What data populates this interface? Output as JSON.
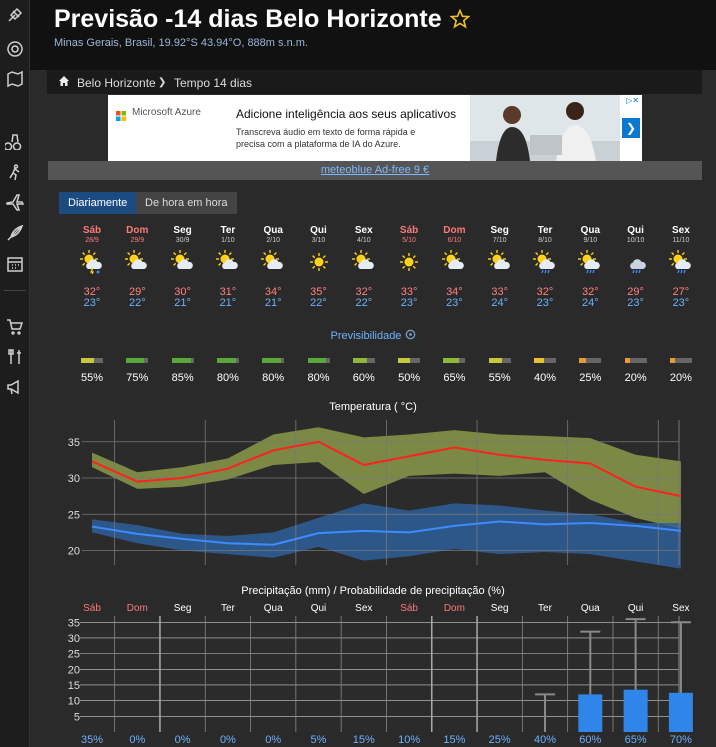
{
  "header": {
    "title": "Previsão -14 dias Belo Horizonte",
    "subtitle": "Minas Gerais, Brasil, 19.92°S 43.94°O, 888m s.n.m."
  },
  "breadcrumb": {
    "home": "Belo Horizonte",
    "sep": "❯",
    "current": "Tempo 14 dias"
  },
  "ad": {
    "brand": "Microsoft Azure",
    "headline": "Adicione inteligência aos seus aplicativos",
    "body1": "Transcreva áudio em texto de forma rápida e",
    "body2": "precisa com a plataforma de IA do Azure."
  },
  "adfree": "meteoblue Ad-free 9 €",
  "tabs": {
    "daily": "Diariamente",
    "hourly": "De hora em hora"
  },
  "sidebar_icons": [
    "satellite-icon",
    "radar-icon",
    "map-icon",
    "binoculars-icon",
    "hiking-icon",
    "plane-icon",
    "feather-icon",
    "calendar-icon",
    "cart-icon",
    "tools-icon",
    "megaphone-icon"
  ],
  "days": [
    {
      "name": "Sáb",
      "date": "28/9",
      "weekend": true,
      "icon": "sun-cloud-thunder",
      "max": "32°",
      "min": "23°",
      "pred": "55%",
      "pred_value": 0.55
    },
    {
      "name": "Dom",
      "date": "29/9",
      "weekend": true,
      "icon": "sun-cloud",
      "max": "29°",
      "min": "22°",
      "pred": "75%",
      "pred_value": 0.75
    },
    {
      "name": "Seg",
      "date": "30/9",
      "weekend": false,
      "icon": "sun-cloud",
      "max": "30°",
      "min": "21°",
      "pred": "85%",
      "pred_value": 0.85
    },
    {
      "name": "Ter",
      "date": "1/10",
      "weekend": false,
      "icon": "sun-cloud",
      "max": "31°",
      "min": "21°",
      "pred": "80%",
      "pred_value": 0.8
    },
    {
      "name": "Qua",
      "date": "2/10",
      "weekend": false,
      "icon": "sun-cloud",
      "max": "34°",
      "min": "21°",
      "pred": "80%",
      "pred_value": 0.8
    },
    {
      "name": "Qui",
      "date": "3/10",
      "weekend": false,
      "icon": "sun",
      "max": "35°",
      "min": "22°",
      "pred": "80%",
      "pred_value": 0.8
    },
    {
      "name": "Sex",
      "date": "4/10",
      "weekend": false,
      "icon": "sun-cloud",
      "max": "32°",
      "min": "22°",
      "pred": "60%",
      "pred_value": 0.6
    },
    {
      "name": "Sáb",
      "date": "5/10",
      "weekend": true,
      "icon": "sun",
      "max": "33°",
      "min": "23°",
      "pred": "50%",
      "pred_value": 0.5
    },
    {
      "name": "Dom",
      "date": "6/10",
      "weekend": true,
      "icon": "sun-cloud",
      "max": "34°",
      "min": "23°",
      "pred": "65%",
      "pred_value": 0.65
    },
    {
      "name": "Seg",
      "date": "7/10",
      "weekend": false,
      "icon": "sun-cloud",
      "max": "33°",
      "min": "24°",
      "pred": "55%",
      "pred_value": 0.55
    },
    {
      "name": "Ter",
      "date": "8/10",
      "weekend": false,
      "icon": "sun-cloud-rain",
      "max": "32°",
      "min": "23°",
      "pred": "40%",
      "pred_value": 0.4
    },
    {
      "name": "Qua",
      "date": "9/10",
      "weekend": false,
      "icon": "sun-cloud-rain",
      "max": "32°",
      "min": "24°",
      "pred": "25%",
      "pred_value": 0.25
    },
    {
      "name": "Qui",
      "date": "10/10",
      "weekend": false,
      "icon": "cloud-rain",
      "max": "29°",
      "min": "23°",
      "pred": "20%",
      "pred_value": 0.2
    },
    {
      "name": "Sex",
      "date": "11/10",
      "weekend": false,
      "icon": "sun-cloud-rain",
      "max": "27°",
      "min": "23°",
      "pred": "20%",
      "pred_value": 0.2
    }
  ],
  "predictability_label": "Previsibilidade",
  "chart_data": [
    {
      "type": "line",
      "title": "Temperatura ( °C)",
      "yticks": [
        "20",
        "25",
        "30",
        "35"
      ],
      "ylim": [
        18,
        38
      ],
      "grid": true,
      "series": [
        {
          "values": [
            32.3,
            29.5,
            30,
            31.3,
            33.8,
            35,
            31.8,
            33,
            34.2,
            33.2,
            32.5,
            32,
            28.8,
            27.5
          ],
          "color": "#ff2020"
        },
        {
          "values": [
            23.3,
            22.3,
            21.6,
            21,
            20.8,
            22.4,
            22.7,
            22.5,
            23.4,
            24,
            23.6,
            23.8,
            23.4,
            22.7
          ],
          "color": "#3d8bff"
        }
      ],
      "max_band": {
        "upper": [
          33.5,
          30.8,
          31.5,
          32.7,
          36,
          37,
          35.6,
          36,
          36.6,
          36,
          35.8,
          35.5,
          33.2,
          32.3
        ],
        "lower": [
          31.5,
          28.5,
          28.8,
          29.8,
          31.8,
          32.2,
          27.8,
          30.3,
          30.6,
          30.3,
          30.8,
          27,
          24.5,
          23
        ],
        "color": "#8a9a4a"
      },
      "min_band": {
        "upper": [
          24.3,
          23.5,
          22.3,
          22,
          22.5,
          24.5,
          26.5,
          25.5,
          26.5,
          26.2,
          25.5,
          25,
          23.8,
          23.8
        ],
        "lower": [
          22.5,
          21,
          20,
          19.5,
          19,
          20.5,
          18.6,
          19.2,
          20.2,
          19.5,
          19.8,
          19.5,
          18.5,
          17.5
        ],
        "color": "#2f5f9a"
      }
    },
    {
      "type": "bar",
      "title": "Precipitação (mm) / Probabilidade de precipitação (%)",
      "categories": [
        "Sáb",
        "Dom",
        "Seg",
        "Ter",
        "Qua",
        "Qui",
        "Sex",
        "Sáb",
        "Dom",
        "Seg",
        "Ter",
        "Qua",
        "Qui",
        "Sex"
      ],
      "weekend": [
        true,
        true,
        false,
        false,
        false,
        false,
        false,
        true,
        true,
        false,
        false,
        false,
        false,
        false
      ],
      "yticks": [
        "5",
        "10",
        "15",
        "20",
        "25",
        "30",
        "35"
      ],
      "ylim": [
        0,
        37
      ],
      "values": [
        0,
        0,
        0,
        0,
        0,
        0,
        0,
        0,
        0,
        0,
        0,
        12,
        13.5,
        12.5
      ],
      "range_max": [
        0,
        0,
        0,
        0,
        0,
        0,
        0,
        0,
        0,
        0,
        12,
        32,
        36,
        35
      ],
      "prob": [
        "35%",
        "0%",
        "0%",
        "0%",
        "0%",
        "5%",
        "15%",
        "10%",
        "15%",
        "25%",
        "40%",
        "60%",
        "65%",
        "70%"
      ],
      "bar_color": "#2f86e8"
    }
  ]
}
